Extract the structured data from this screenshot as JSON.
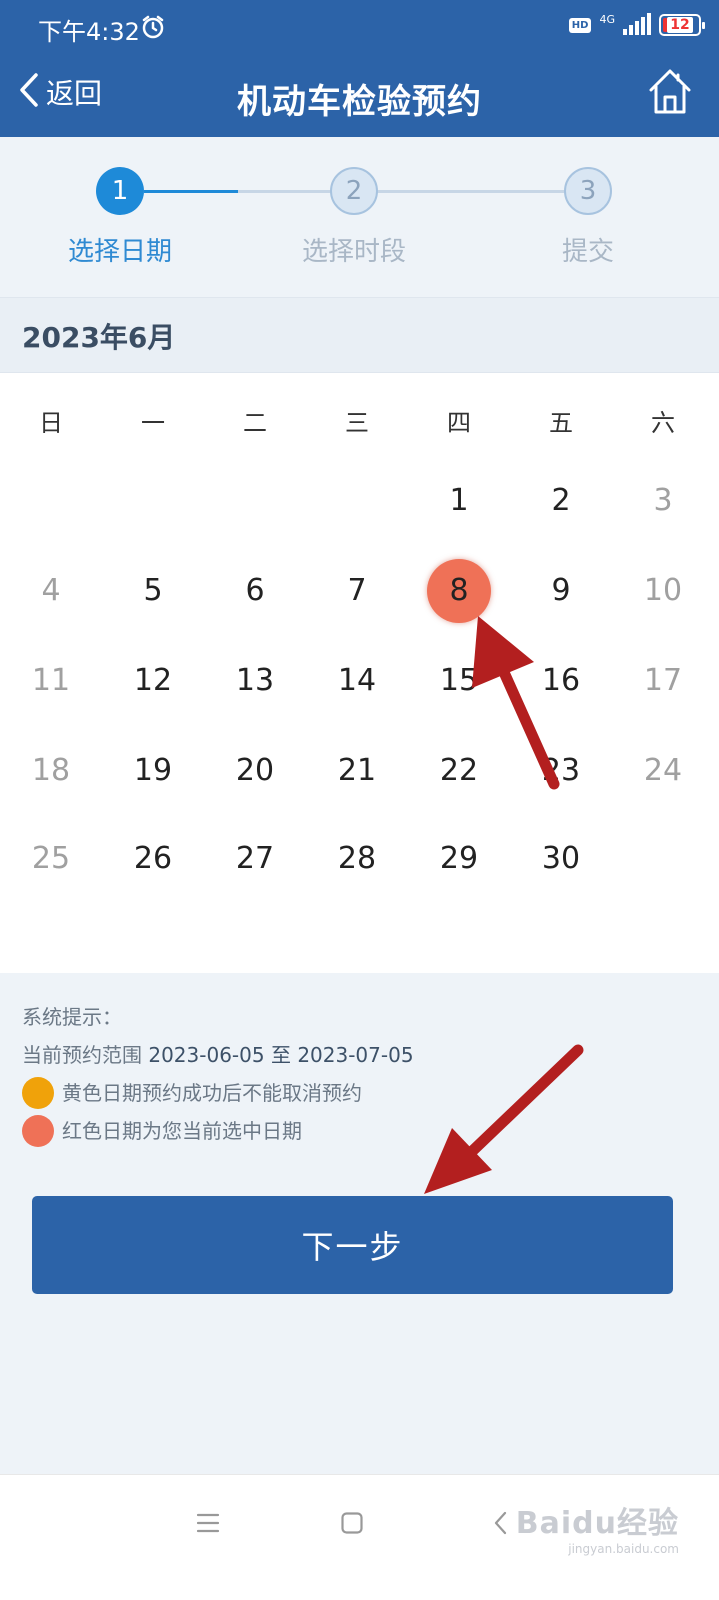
{
  "status_bar": {
    "time": "下午4:32",
    "hd": "HD",
    "network": "4G",
    "battery": "12"
  },
  "nav": {
    "back_label": "返回",
    "title": "机动车检验预约"
  },
  "steps": [
    {
      "number": "1",
      "label": "选择日期",
      "state": "active"
    },
    {
      "number": "2",
      "label": "选择时段",
      "state": "inactive"
    },
    {
      "number": "3",
      "label": "提交",
      "state": "inactive"
    }
  ],
  "calendar": {
    "month_label": "2023年6月",
    "weekdays": [
      "日",
      "一",
      "二",
      "三",
      "四",
      "五",
      "六"
    ],
    "weeks": [
      [
        "",
        "",
        "",
        "",
        "1",
        "2",
        "3"
      ],
      [
        "4",
        "5",
        "6",
        "7",
        "8",
        "9",
        "10"
      ],
      [
        "11",
        "12",
        "13",
        "14",
        "15",
        "16",
        "17"
      ],
      [
        "18",
        "19",
        "20",
        "21",
        "22",
        "23",
        "24"
      ],
      [
        "25",
        "26",
        "27",
        "28",
        "29",
        "30",
        ""
      ]
    ],
    "selected_day": "8"
  },
  "hints": {
    "title": "系统提示：",
    "range_prefix": "当前预约范围",
    "range_start": "2023-06-05",
    "range_sep": "至",
    "range_end": "2023-07-05",
    "legend_yellow": "黄色日期预约成功后不能取消预约",
    "legend_red": "红色日期为您当前选中日期"
  },
  "next_button_label": "下一步",
  "watermark": {
    "logo": "Baidu经验",
    "sub": "jingyan.baidu.com"
  },
  "colors": {
    "primary": "#2c63a8",
    "step_active": "#1e8ad8",
    "selected": "#ef7157",
    "yellow": "#f0a20a",
    "arrow": "#b31f1f"
  }
}
